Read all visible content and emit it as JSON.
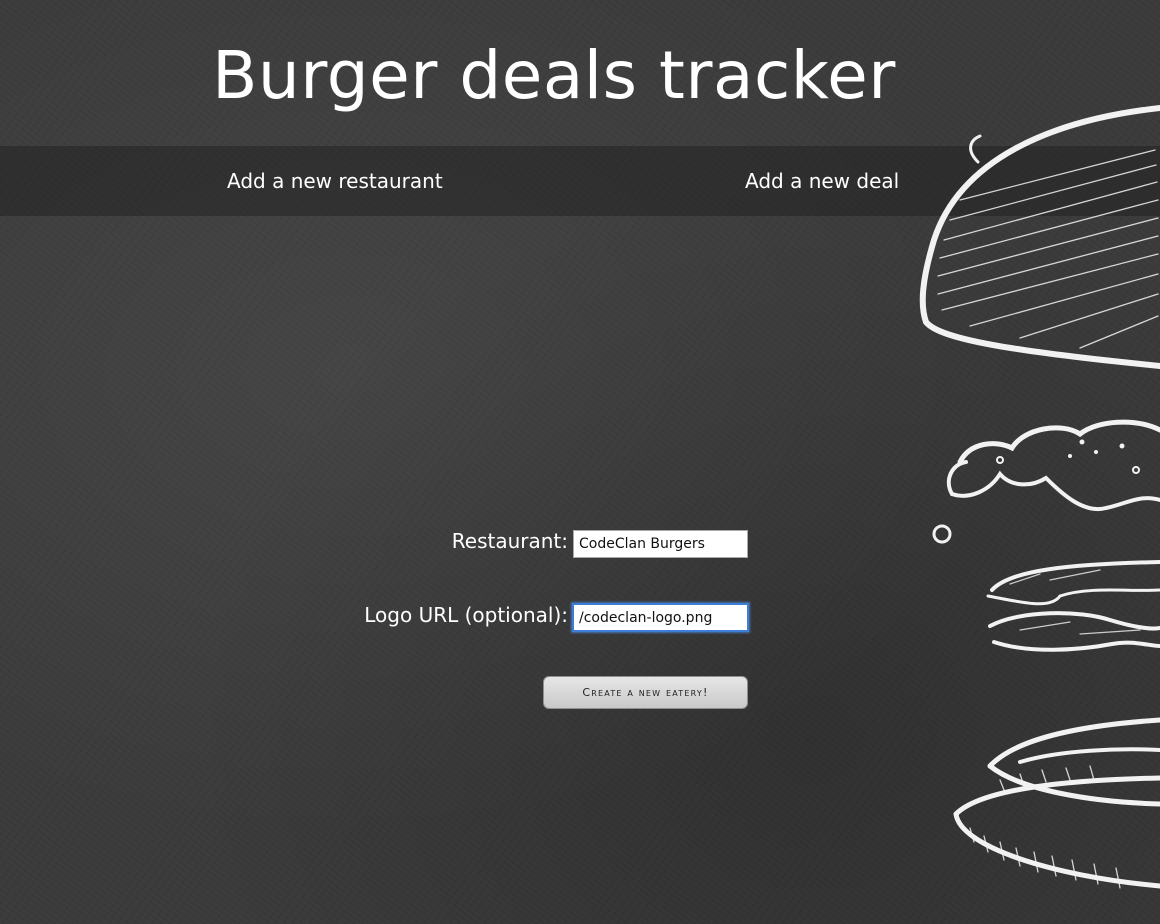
{
  "header": {
    "title": "Burger deals tracker"
  },
  "nav": {
    "items": [
      {
        "label": "Add a new restaurant"
      },
      {
        "label": "Add a new deal"
      }
    ]
  },
  "form": {
    "restaurant": {
      "label": "Restaurant:",
      "value": "CodeClan Burgers"
    },
    "logo_url": {
      "label": "Logo URL (optional):",
      "value": "/codeclan-logo.png"
    },
    "submit_label": "Create a new eatery!"
  },
  "colors": {
    "background": "#3b3b3b",
    "nav_band": "#2a2a2a",
    "text": "#ffffff",
    "input_focus": "#3d7fd6"
  },
  "icons": {
    "background_illustration": "burger-illustration"
  }
}
